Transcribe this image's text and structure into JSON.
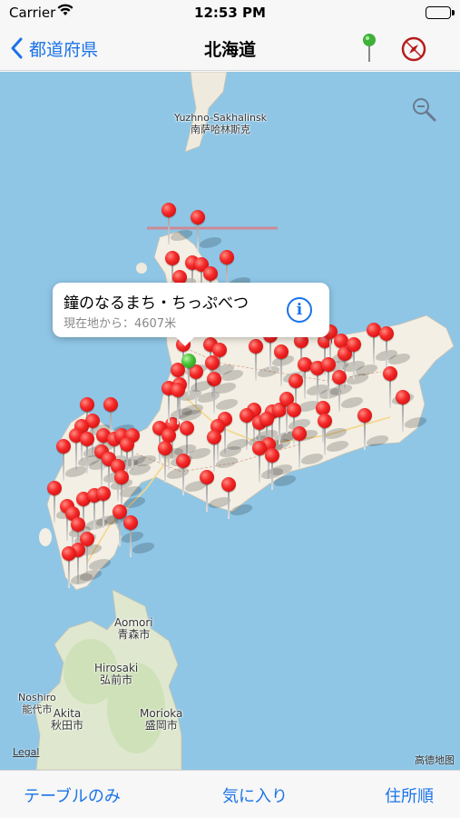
{
  "status": {
    "carrier": "Carrier",
    "time": "12:53 PM"
  },
  "nav": {
    "back_label": "都道府県",
    "title": "北海道"
  },
  "map": {
    "labels": {
      "sakhalin_en": "Yuzhno-Sakhalinsk",
      "sakhalin_zh": "南萨哈林斯克",
      "aomori_en": "Aomori",
      "aomori_ja": "青森市",
      "hirosaki_en": "Hirosaki",
      "hirosaki_ja": "弘前市",
      "noshiro_en": "Noshiro",
      "noshiro_ja": "能代市",
      "akita_en": "Akita",
      "akita_ja": "秋田市",
      "morioka_en": "Morioka",
      "morioka_ja": "盛岡市"
    },
    "legal": "Legal",
    "attribution": "高德地图",
    "sea_color": "#8fc6e6",
    "land_color": "#f3efe4",
    "pin_color": "#f42b2b",
    "current_pin_color": "#4cc43a"
  },
  "callout": {
    "title": "鐘のなるまち・ちっぷべつ",
    "subtitle": "現在地から：4607米",
    "info_label": "i"
  },
  "toolbar": {
    "table_only": "テーブルのみ",
    "favorites": "気に入り",
    "address_order": "住所順"
  },
  "accent_color": "#1a73e8"
}
